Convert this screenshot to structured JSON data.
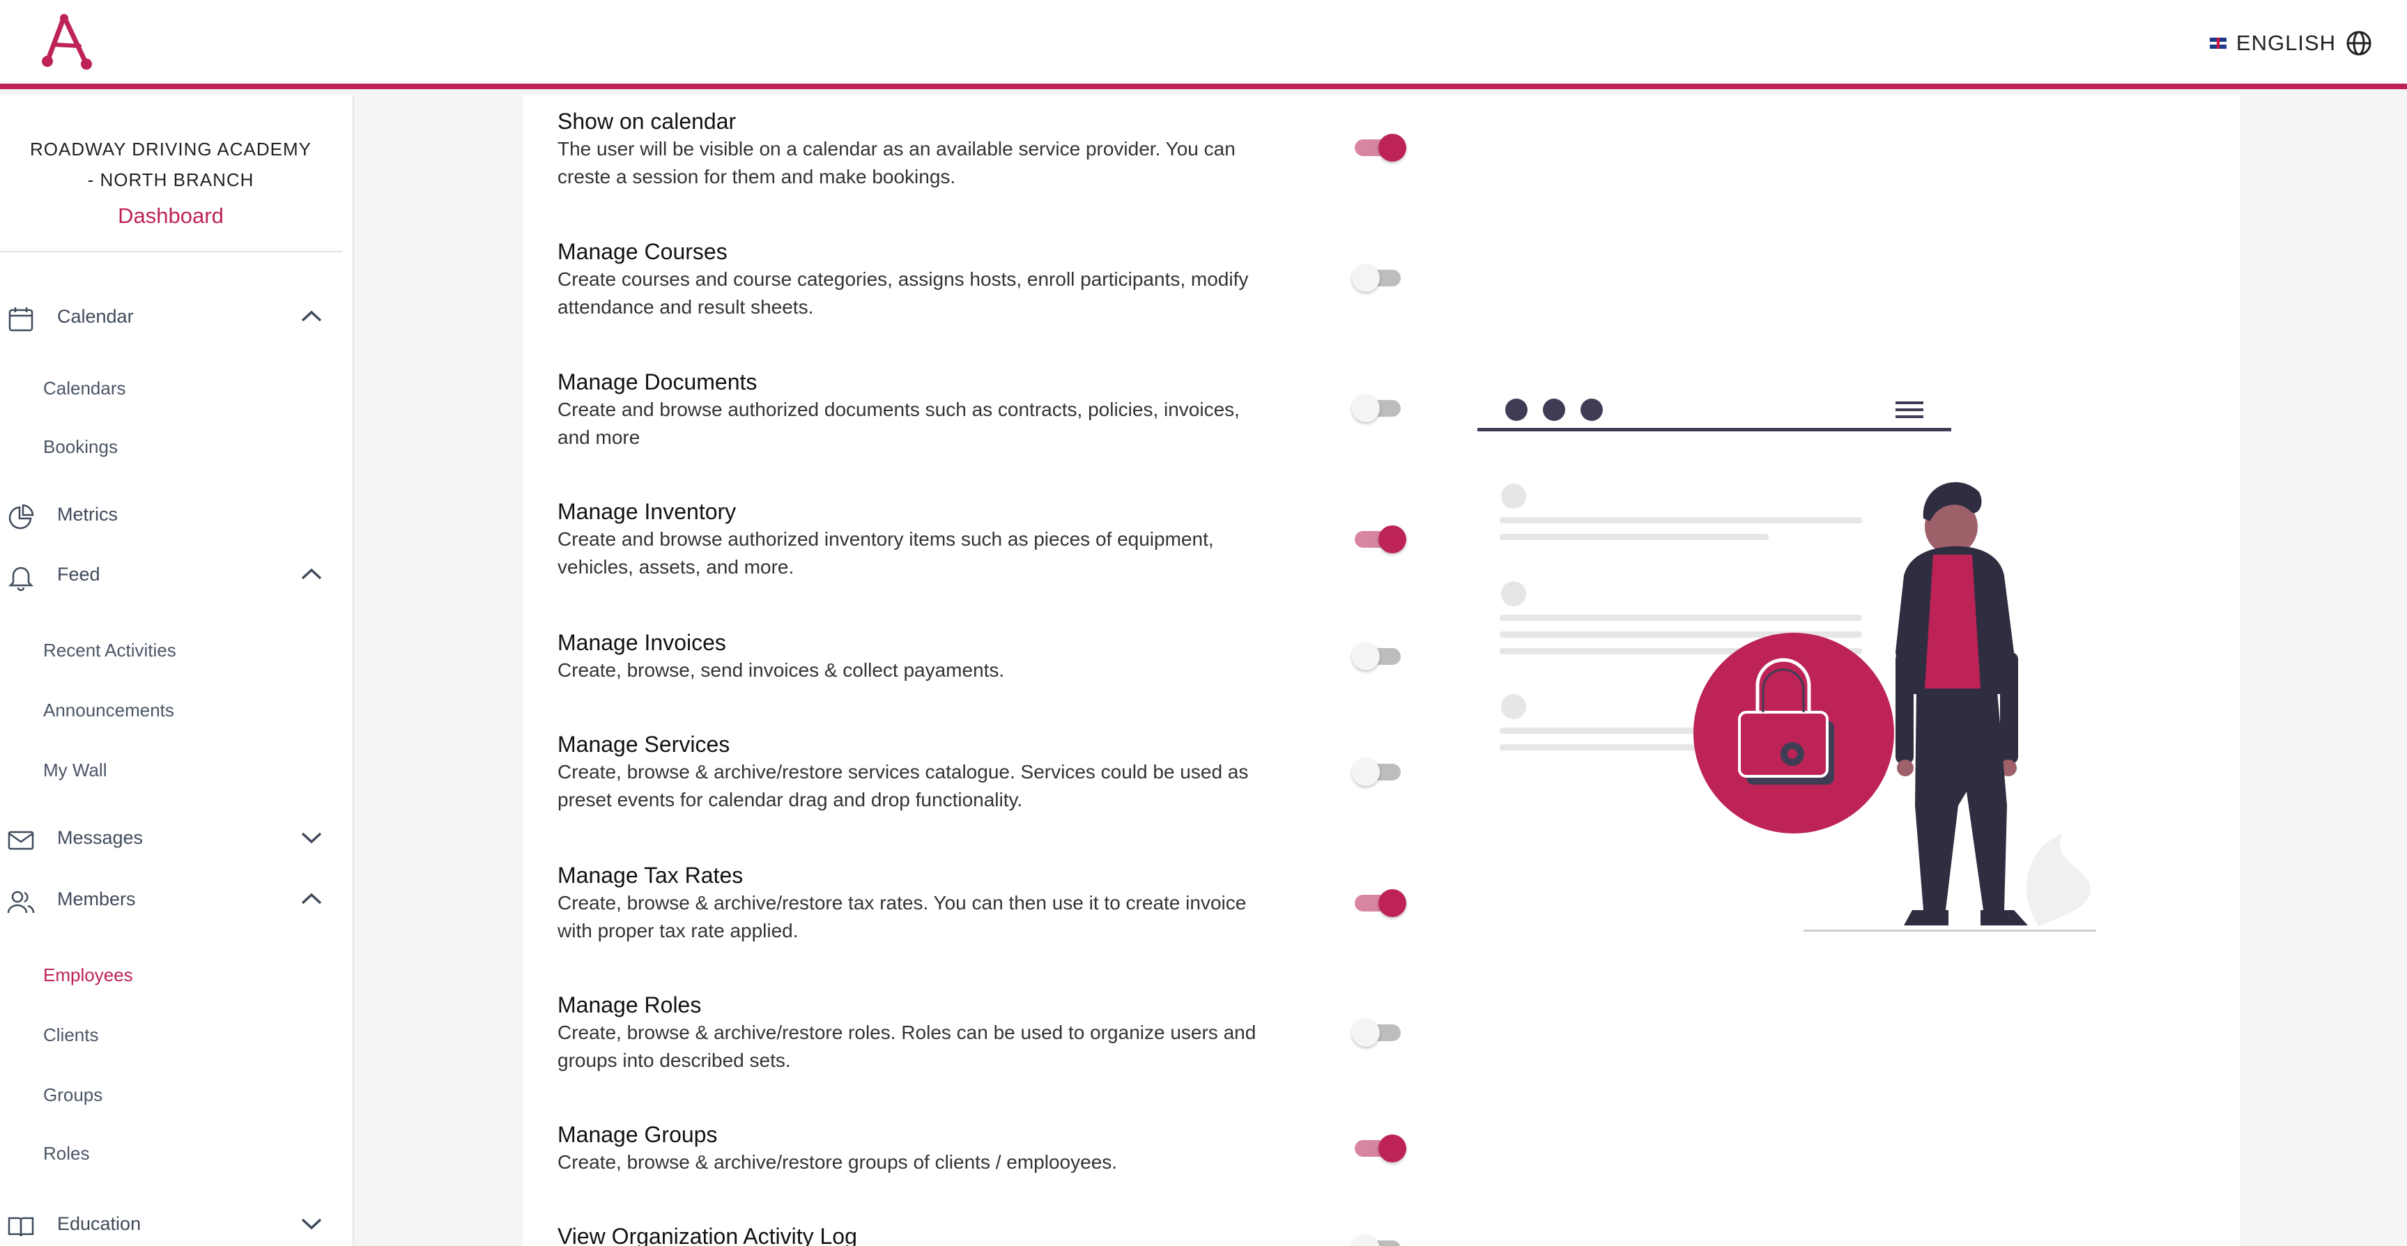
{
  "app": {
    "language": "ENGLISH"
  },
  "sidebar": {
    "org_name_line1": "ROADWAY DRIVING ACADEMY",
    "org_name_line2": "- NORTH BRANCH",
    "dashboard_link": "Dashboard",
    "sections": {
      "calendar": {
        "label": "Calendar",
        "expanded": true,
        "items": [
          "Calendars",
          "Bookings"
        ]
      },
      "metrics": {
        "label": "Metrics"
      },
      "feed": {
        "label": "Feed",
        "expanded": true,
        "items": [
          "Recent Activities",
          "Announcements",
          "My Wall"
        ]
      },
      "messages": {
        "label": "Messages",
        "expanded": false
      },
      "members": {
        "label": "Members",
        "expanded": true,
        "items": [
          "Employees",
          "Clients",
          "Groups",
          "Roles"
        ],
        "active": "Employees"
      },
      "education": {
        "label": "Education",
        "expanded": false
      }
    }
  },
  "permissions": [
    {
      "title": "Show on calendar",
      "desc_line1": "The user will be visible on a calendar as an available service provider. You can",
      "desc_line2": "creste a session for them and make bookings.",
      "enabled": true
    },
    {
      "title": "Manage Courses",
      "desc_line1": "Create courses and course categories, assigns hosts, enroll participants, modify",
      "desc_line2": "attendance and result sheets.",
      "enabled": false
    },
    {
      "title": "Manage Documents",
      "desc_line1": "Create and browse authorized documents such as contracts, policies, invoices,",
      "desc_line2": "and more",
      "enabled": false
    },
    {
      "title": "Manage Inventory",
      "desc_line1": "Create and browse authorized inventory items such as pieces of equipment,",
      "desc_line2": "vehicles, assets, and more.",
      "enabled": true
    },
    {
      "title": "Manage Invoices",
      "desc_line1": "Create, browse, send invoices & collect payaments.",
      "desc_line2": "",
      "enabled": false
    },
    {
      "title": "Manage Services",
      "desc_line1": "Create, browse & archive/restore services catalogue. Services could be used as",
      "desc_line2": "preset events for calendar drag and drop functionality.",
      "enabled": false
    },
    {
      "title": "Manage Tax Rates",
      "desc_line1": "Create, browse & archive/restore tax rates. You can then use it to create invoice",
      "desc_line2": "with proper tax rate applied.",
      "enabled": true
    },
    {
      "title": "Manage Roles",
      "desc_line1": "Create, browse & archive/restore roles. Roles can be used to organize users and",
      "desc_line2": "groups into described sets.",
      "enabled": false
    },
    {
      "title": "Manage Groups",
      "desc_line1": "Create, browse & archive/restore groups of clients / emplooyees.",
      "desc_line2": "",
      "enabled": true
    },
    {
      "title": "View Organization Activity Log",
      "desc_line1": "",
      "desc_line2": "",
      "enabled": false
    }
  ],
  "colors": {
    "brand": "#bd2356",
    "toggle_on_track": "#d8869f",
    "toggle_off_track": "#bdbdbd",
    "dark": "#2f2e41"
  }
}
